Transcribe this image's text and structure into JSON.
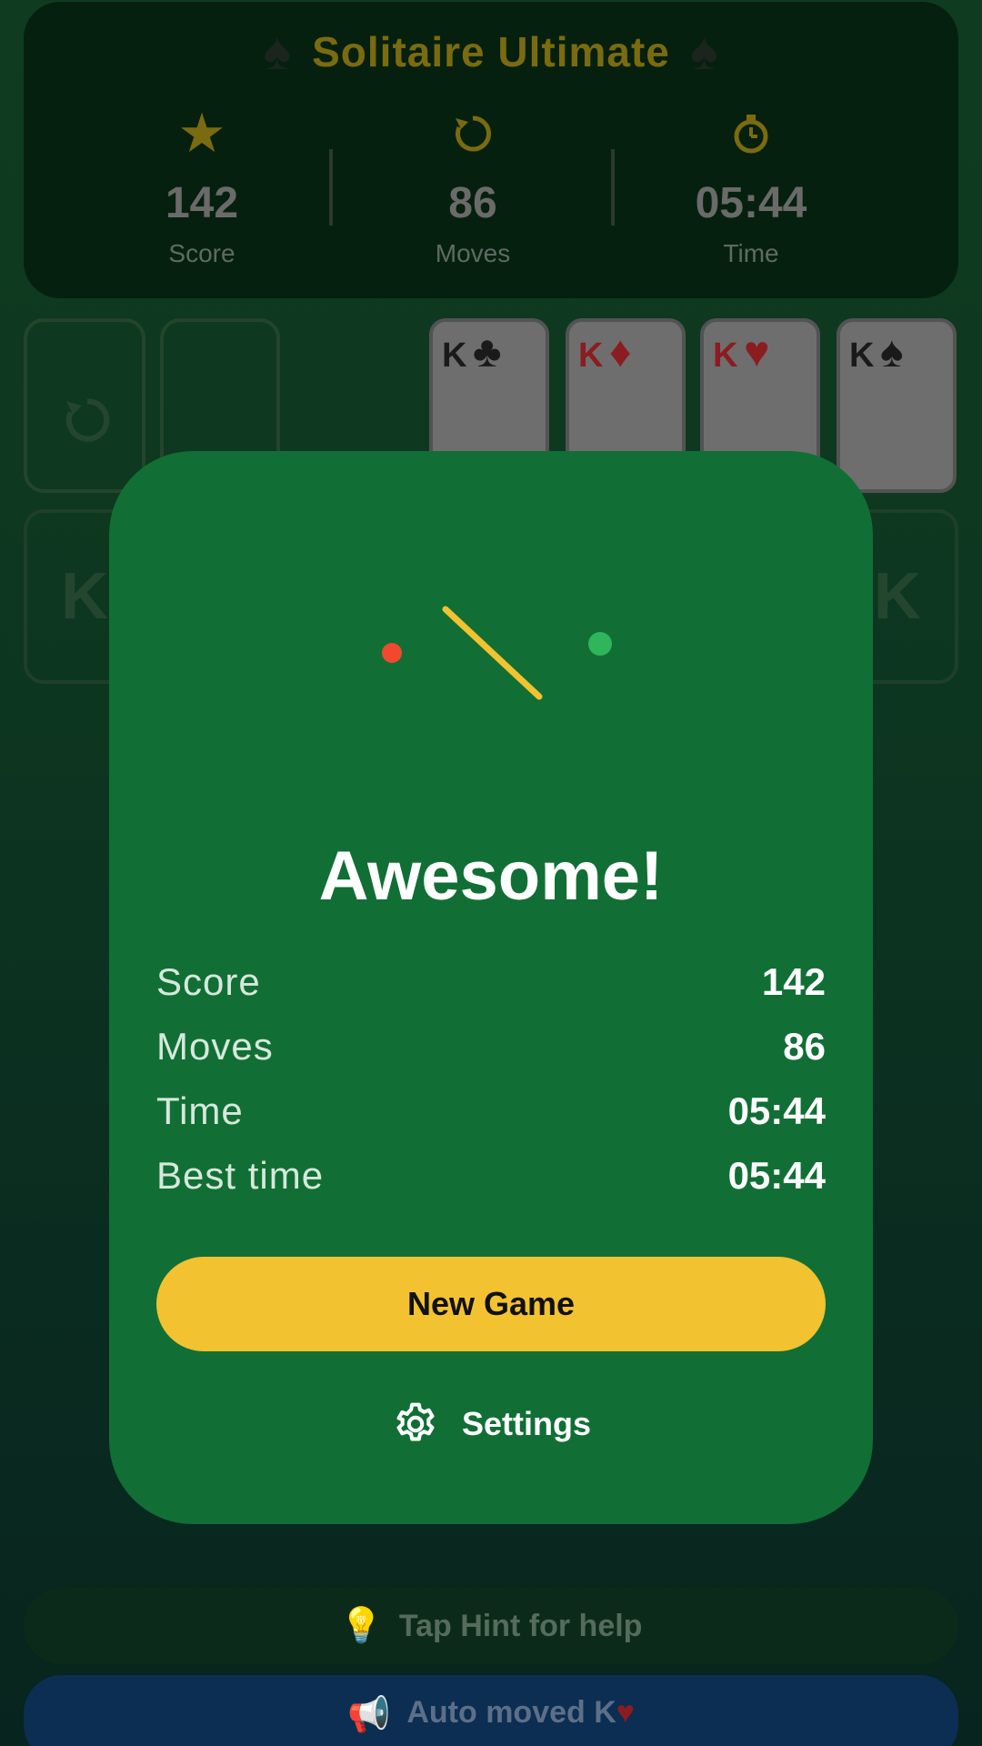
{
  "header": {
    "title": "Solitaire Ultimate",
    "stats": [
      {
        "icon": "star-icon",
        "value": "142",
        "label": "Score"
      },
      {
        "icon": "restart-icon",
        "value": "86",
        "label": "Moves"
      },
      {
        "icon": "stopwatch-icon",
        "value": "05:44",
        "label": "Time"
      }
    ]
  },
  "foundations": [
    {
      "rank": "K",
      "suit": "♣",
      "color": "#1a1a1a"
    },
    {
      "rank": "K",
      "suit": "♦",
      "color": "#8b1c1f"
    },
    {
      "rank": "K",
      "suit": "♥",
      "color": "#8b1c1f"
    },
    {
      "rank": "K",
      "suit": "♠",
      "color": "#1a1a1a"
    }
  ],
  "tableau": {
    "left_label": "K",
    "right_label": "K"
  },
  "modal": {
    "heading": "Awesome!",
    "rows": [
      {
        "label": "Score",
        "value": "142"
      },
      {
        "label": "Moves",
        "value": "86"
      },
      {
        "label": "Time",
        "value": "05:44"
      },
      {
        "label": "Best time",
        "value": "05:44"
      }
    ],
    "new_game_label": "New Game",
    "settings_label": "Settings"
  },
  "hint_bar": {
    "icon": "lightbulb-icon",
    "text": "Tap Hint for help"
  },
  "status_bar": {
    "icon": "megaphone-icon",
    "text": "Auto moved K",
    "suit": "♥"
  },
  "colors": {
    "accent_yellow": "#f2c230",
    "modal_green": "#116f35",
    "header_bg": "#06200f",
    "status_blue": "#0b2e52"
  }
}
